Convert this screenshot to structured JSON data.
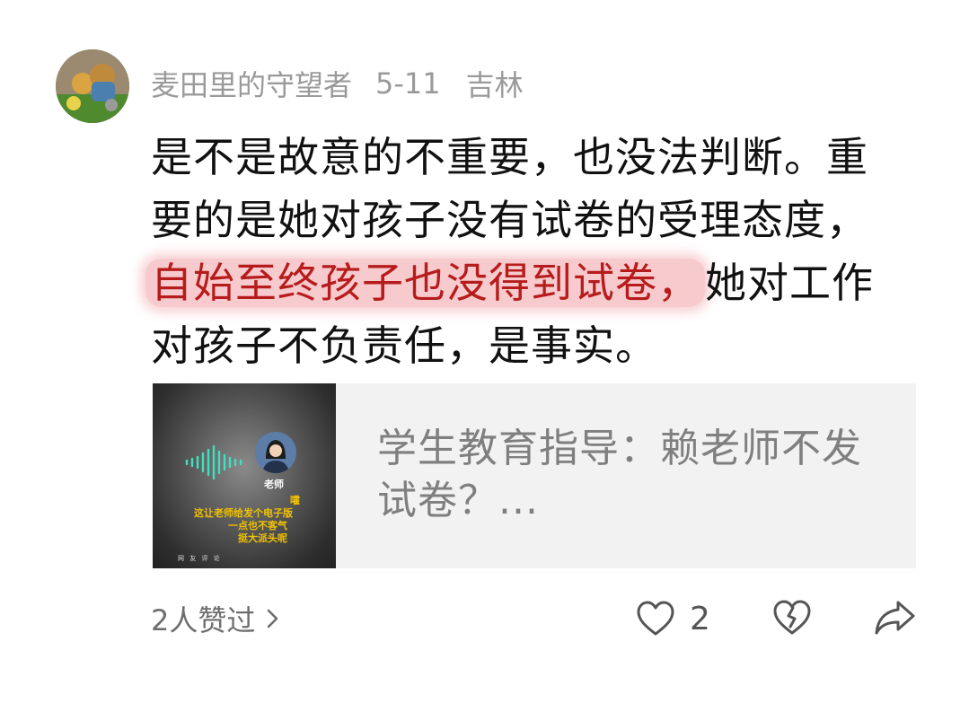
{
  "comment": {
    "username": "麦田里的守望者",
    "date": "5-11",
    "location": "吉林",
    "lines": [
      "是不是故意的不重要，也没法判断。重",
      "要的是她对孩子没有试卷的受理态度，"
    ],
    "highlighted": "自始至终孩子也没得到试卷，",
    "line3_rest": "她对工作",
    "line4": "对孩子不负责任，是事实。"
  },
  "link_card": {
    "title": "学生教育指导：赖老师不发试卷？...",
    "thumbnail": {
      "teacher_label": "老师",
      "caption_lines": [
        "嚯",
        "这让老师给发个电子版",
        "一点也不客气",
        "挺大派头呢"
      ],
      "footer": "网 友 评 论"
    }
  },
  "footer": {
    "likes_text": "2人赞过",
    "like_count": "2",
    "icons": [
      "heart-icon",
      "broken-heart-icon",
      "share-arrow-icon",
      "chevron-right-icon"
    ]
  },
  "colors": {
    "highlight_text": "#b71c1c",
    "highlight_bg": "#e75a64",
    "meta_gray": "#9a9a9a",
    "card_bg": "#f2f2f2"
  }
}
